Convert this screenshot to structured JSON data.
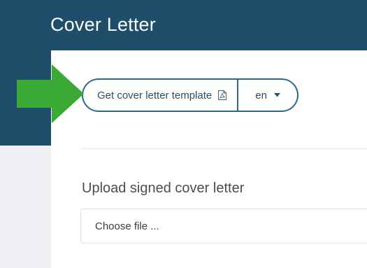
{
  "page": {
    "title": "Cover Letter"
  },
  "toolbar": {
    "template_button_label": "Get cover letter template",
    "template_icon": "pdf-file-icon",
    "language_value": "en",
    "language_icon": "caret-down-icon"
  },
  "upload": {
    "label": "Upload signed cover letter",
    "file_input_placeholder": "Choose file ..."
  },
  "annotation": {
    "arrow_icon": "green-arrow-pointer",
    "arrow_color": "#3aaa35"
  },
  "colors": {
    "header": "#1f4e6b",
    "accent": "#2d6a8a"
  }
}
